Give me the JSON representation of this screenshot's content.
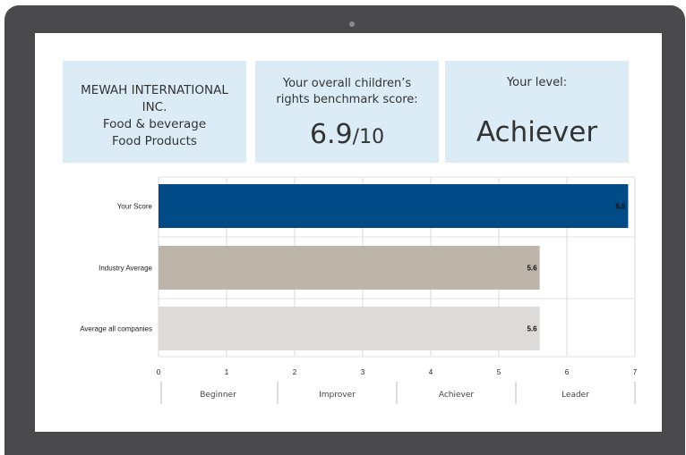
{
  "company": {
    "line1": "MEWAH INTERNATIONAL",
    "line2": "INC.",
    "line3": "Food & beverage",
    "line4": "Food Products"
  },
  "score_card": {
    "label": "Your overall children’s rights benchmark score:",
    "value": "6.9",
    "denominator": "/10"
  },
  "level_card": {
    "label": "Your level:",
    "value": "Achiever"
  },
  "chart_data": {
    "type": "bar",
    "orientation": "horizontal",
    "categories": [
      "Your Score",
      "Industry Average",
      "Average all companies"
    ],
    "values": [
      6.9,
      5.6,
      5.6
    ],
    "value_labels": [
      "6.9",
      "5.6",
      "5.6"
    ],
    "bar_colors": [
      "#004b87",
      "#bdb5aa",
      "#dcdbd9"
    ],
    "xlim": [
      0,
      7
    ],
    "x_ticks": [
      "0",
      "1",
      "2",
      "3",
      "4",
      "5",
      "6",
      "7"
    ],
    "grid": true,
    "level_bands": [
      {
        "label": "Beginner",
        "from": 0,
        "to": 1.75
      },
      {
        "label": "Improver",
        "from": 1.75,
        "to": 3.5
      },
      {
        "label": "Achiever",
        "from": 3.5,
        "to": 5.25
      },
      {
        "label": "Leader",
        "from": 5.25,
        "to": 7
      }
    ]
  }
}
